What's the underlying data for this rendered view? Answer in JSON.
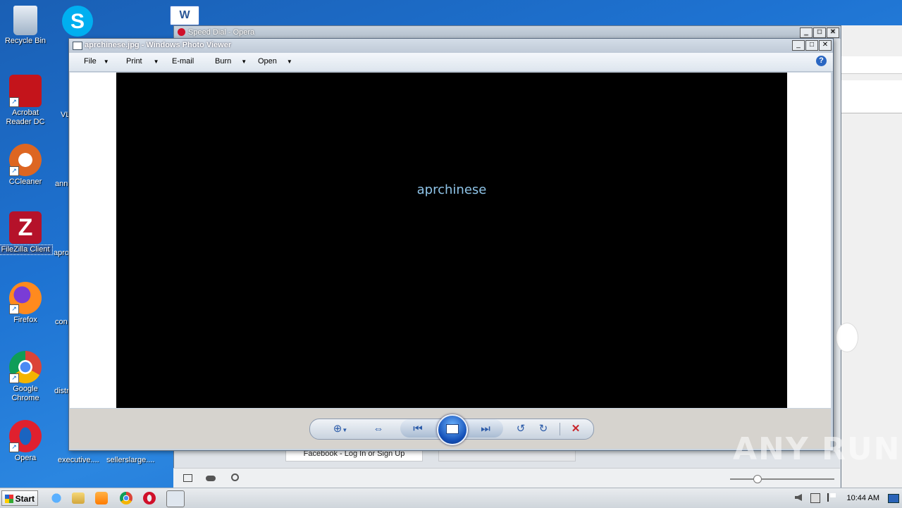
{
  "desktop": {
    "icons": [
      {
        "label": "Recycle Bin"
      },
      {
        "label": "Acrobat Reader DC"
      },
      {
        "label": "CCleaner"
      },
      {
        "label": "FileZilla Client"
      },
      {
        "label": "Firefox"
      },
      {
        "label": "Google Chrome"
      },
      {
        "label": "Opera"
      }
    ],
    "partial_labels": [
      "VL",
      "ann",
      "apro",
      "con",
      "distr",
      "executive....",
      "sellerslarge...."
    ]
  },
  "opera_window": {
    "title": "Speed Dial - Opera",
    "tab_label": "Facebook - Log In or Sign Up"
  },
  "photo_viewer": {
    "title": "aprchinese.jpg - Windows Photo Viewer",
    "menu": [
      "File",
      "Print",
      "E-mail",
      "Burn",
      "Open"
    ],
    "help_label": "?",
    "image_text": "aprchinese",
    "controls": {
      "zoom": "zoom-icon",
      "actual_size": "actual-size-icon",
      "previous": "previous-icon",
      "slideshow": "slideshow-icon",
      "next": "next-icon",
      "rotate_ccw": "rotate-ccw-icon",
      "rotate_cw": "rotate-cw-icon",
      "delete": "delete-icon"
    }
  },
  "taskbar": {
    "start_label": "Start",
    "clock": "10:44 AM"
  },
  "watermark": "ANY RUN"
}
